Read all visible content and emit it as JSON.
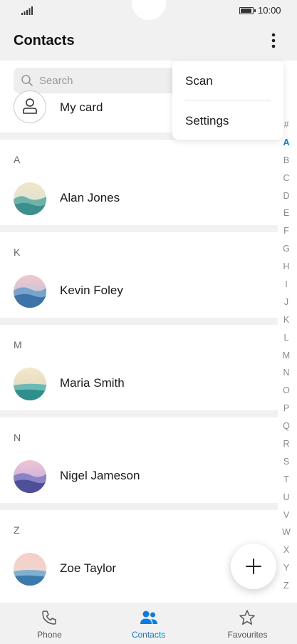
{
  "status": {
    "time": "10:00"
  },
  "header": {
    "title": "Contacts"
  },
  "search": {
    "placeholder": "Search"
  },
  "my_card": {
    "label": "My card"
  },
  "menu": {
    "items": [
      "Scan",
      "Settings"
    ]
  },
  "sections": [
    {
      "letter": "A",
      "contact": "Alan Jones"
    },
    {
      "letter": "K",
      "contact": "Kevin Foley"
    },
    {
      "letter": "M",
      "contact": "Maria Smith"
    },
    {
      "letter": "N",
      "contact": "Nigel Jameson"
    },
    {
      "letter": "Z",
      "contact": "Zoe Taylor"
    }
  ],
  "index": {
    "letters": [
      "#",
      "A",
      "B",
      "C",
      "D",
      "E",
      "F",
      "G",
      "H",
      "I",
      "J",
      "K",
      "L",
      "M",
      "N",
      "O",
      "P",
      "Q",
      "R",
      "S",
      "T",
      "U",
      "V",
      "W",
      "X",
      "Y",
      "Z"
    ],
    "active": "A"
  },
  "nav": {
    "tabs": [
      "Phone",
      "Contacts",
      "Favourites"
    ],
    "active": "Contacts"
  },
  "colors": {
    "accent": "#0a7ce6",
    "background": "#f1f1f1"
  }
}
